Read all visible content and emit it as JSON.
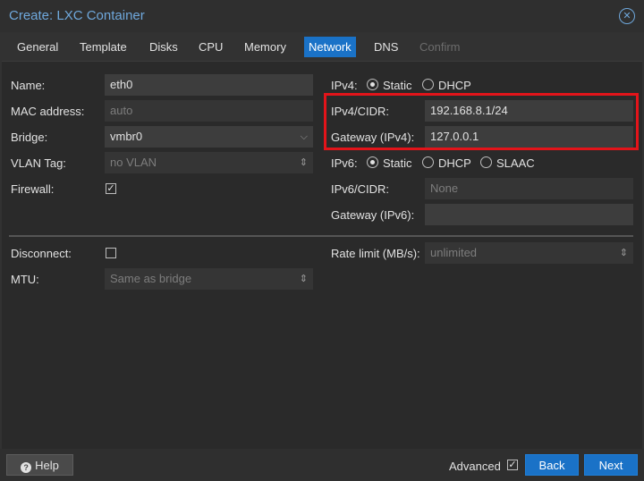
{
  "window": {
    "title": "Create: LXC Container"
  },
  "tabs": [
    {
      "label": "General"
    },
    {
      "label": "Template"
    },
    {
      "label": "Disks"
    },
    {
      "label": "CPU"
    },
    {
      "label": "Memory"
    },
    {
      "label": "Network"
    },
    {
      "label": "DNS"
    },
    {
      "label": "Confirm"
    }
  ],
  "left": {
    "name_label": "Name:",
    "name_value": "eth0",
    "mac_label": "MAC address:",
    "mac_placeholder": "auto",
    "bridge_label": "Bridge:",
    "bridge_value": "vmbr0",
    "vlan_label": "VLAN Tag:",
    "vlan_placeholder": "no VLAN",
    "firewall_label": "Firewall:",
    "firewall_checked": true,
    "disconnect_label": "Disconnect:",
    "disconnect_checked": false,
    "mtu_label": "MTU:",
    "mtu_placeholder": "Same as bridge"
  },
  "right": {
    "ipv4_label": "IPv4:",
    "ipv4_static": "Static",
    "ipv4_dhcp": "DHCP",
    "ipv4cidr_label": "IPv4/CIDR:",
    "ipv4cidr_value": "192.168.8.1/24",
    "gw4_label": "Gateway (IPv4):",
    "gw4_value": "127.0.0.1",
    "ipv6_label": "IPv6:",
    "ipv6_static": "Static",
    "ipv6_dhcp": "DHCP",
    "ipv6_slaac": "SLAAC",
    "ipv6cidr_label": "IPv6/CIDR:",
    "ipv6cidr_placeholder": "None",
    "gw6_label": "Gateway (IPv6):",
    "gw6_value": "",
    "rate_label": "Rate limit (MB/s):",
    "rate_placeholder": "unlimited"
  },
  "footer": {
    "help": "Help",
    "advanced": "Advanced",
    "advanced_checked": true,
    "back": "Back",
    "next": "Next"
  },
  "colors": {
    "accent": "#1a72c7",
    "highlight": "#e3141a",
    "title": "#6fa8dc"
  }
}
